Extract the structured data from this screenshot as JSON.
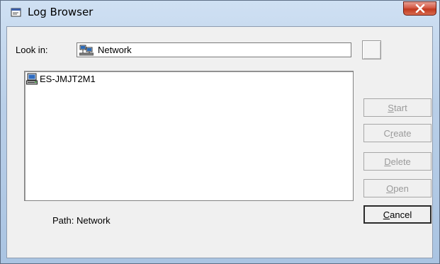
{
  "window": {
    "title": "Log Browser",
    "close_symbol": "✕"
  },
  "lookin": {
    "label": "Look in:",
    "value": "Network",
    "icon": "network-icon"
  },
  "list": {
    "items": [
      {
        "label": "ES-JMJT2M1",
        "icon": "computer-icon"
      }
    ]
  },
  "buttons": {
    "start": {
      "first": "S",
      "rest": "tart",
      "enabled": false
    },
    "create": {
      "pre": "C",
      "ul": "r",
      "rest": "eate",
      "enabled": false
    },
    "delete": {
      "first": "D",
      "rest": "elete",
      "enabled": false
    },
    "open": {
      "first": "O",
      "rest": "pen",
      "enabled": false
    },
    "cancel": {
      "first": "C",
      "rest": "ancel",
      "enabled": true
    }
  },
  "path": {
    "text": "Path:  Network"
  }
}
